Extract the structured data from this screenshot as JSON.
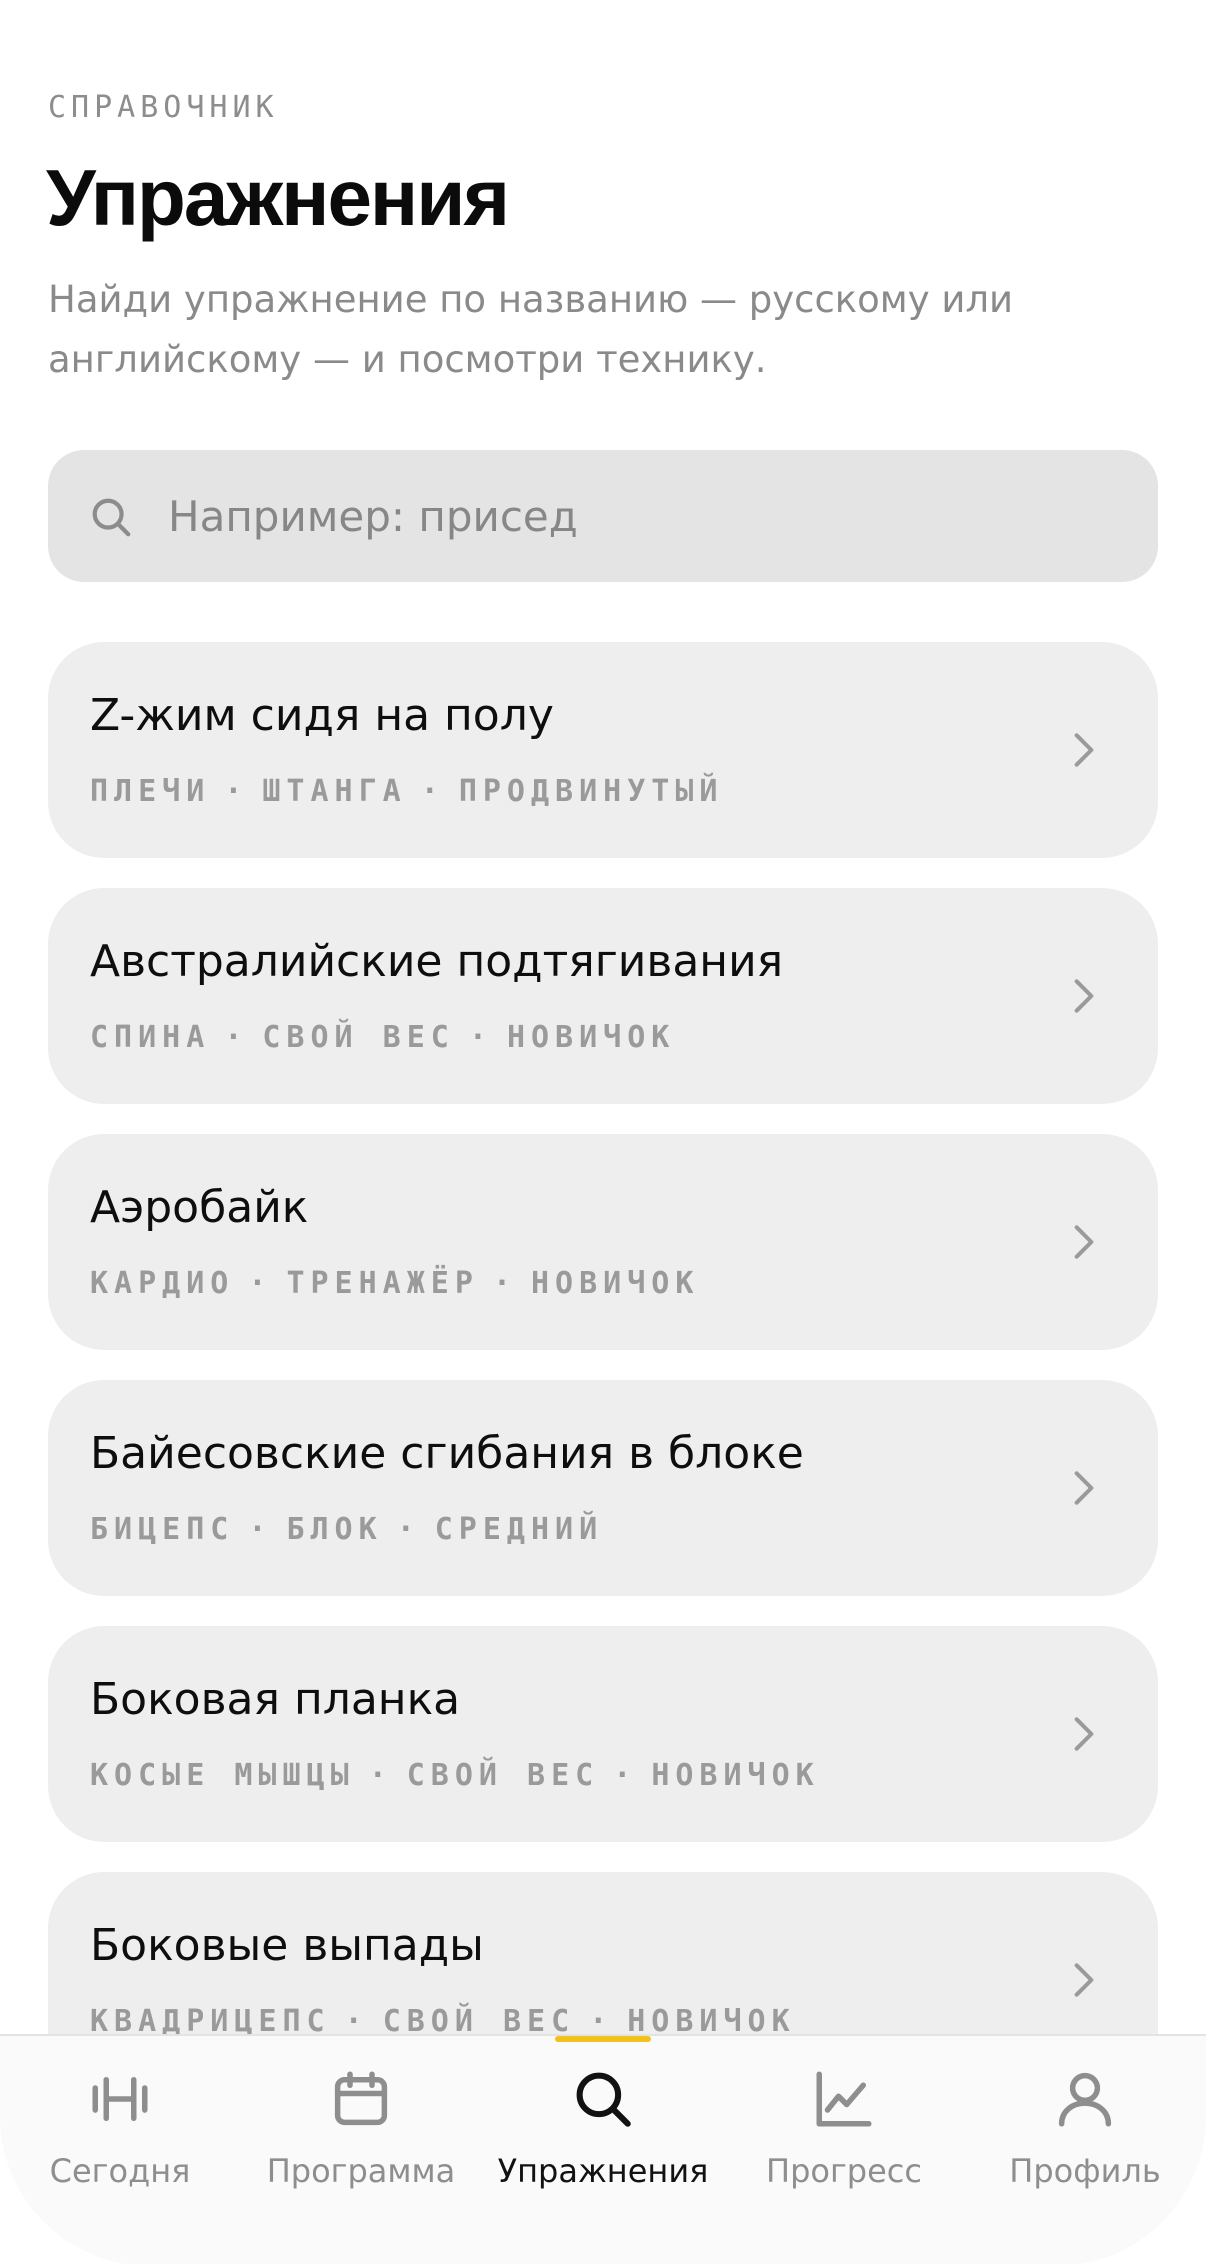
{
  "header": {
    "kicker": "СПРАВОЧНИК",
    "title": "Упражнения",
    "subtitle": "Найди упражнение по названию — русскому или английскому — и посмотри технику."
  },
  "search": {
    "placeholder": "Например: присед",
    "value": "",
    "icon": "search-icon"
  },
  "exercises": [
    {
      "name": "Z-жим сидя на полу",
      "tags": [
        "ПЛЕЧИ",
        "ШТАНГА",
        "ПРОДВИНУТЫЙ"
      ]
    },
    {
      "name": "Австралийские подтягивания",
      "tags": [
        "СПИНА",
        "СВОЙ ВЕС",
        "НОВИЧОК"
      ]
    },
    {
      "name": "Аэробайк",
      "tags": [
        "КАРДИО",
        "ТРЕНАЖЁР",
        "НОВИЧОК"
      ]
    },
    {
      "name": "Байесовские сгибания в блоке",
      "tags": [
        "БИЦЕПС",
        "БЛОК",
        "СРЕДНИЙ"
      ]
    },
    {
      "name": "Боковая планка",
      "tags": [
        "КОСЫЕ МЫШЦЫ",
        "СВОЙ ВЕС",
        "НОВИЧОК"
      ]
    },
    {
      "name": "Боковые выпады",
      "tags": [
        "КВАДРИЦЕПС",
        "СВОЙ ВЕС",
        "НОВИЧОК"
      ]
    }
  ],
  "tag_separator": "·",
  "tabbar": {
    "active_index": 2,
    "accent_color": "#f1c21b",
    "tabs": [
      {
        "label": "Сегодня",
        "icon": "barbell-icon"
      },
      {
        "label": "Программа",
        "icon": "calendar-icon"
      },
      {
        "label": "Упражнения",
        "icon": "search-icon"
      },
      {
        "label": "Прогресс",
        "icon": "chart-icon"
      },
      {
        "label": "Профиль",
        "icon": "user-icon"
      }
    ]
  }
}
